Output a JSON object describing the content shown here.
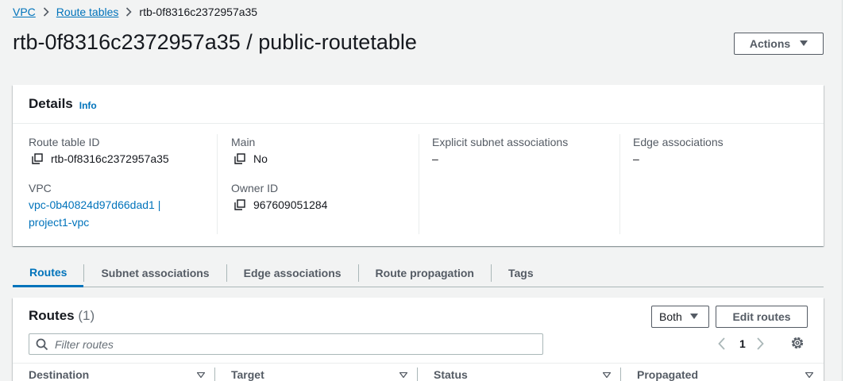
{
  "breadcrumb": {
    "items": [
      "VPC",
      "Route tables"
    ],
    "current": "rtb-0f8316c2372957a35"
  },
  "page": {
    "title": "rtb-0f8316c2372957a35 / public-routetable",
    "actions_label": "Actions"
  },
  "details": {
    "heading": "Details",
    "info_label": "Info",
    "route_table_id_label": "Route table ID",
    "route_table_id_value": "rtb-0f8316c2372957a35",
    "vpc_label": "VPC",
    "vpc_value_line1": "vpc-0b40824d97d66dad1 |",
    "vpc_value_line2": "project1-vpc",
    "main_label": "Main",
    "main_value": "No",
    "owner_id_label": "Owner ID",
    "owner_id_value": "967609051284",
    "explicit_label": "Explicit subnet associations",
    "explicit_value": "–",
    "edge_label": "Edge associations",
    "edge_value": "–"
  },
  "tabs": [
    {
      "label": "Routes",
      "active": true
    },
    {
      "label": "Subnet associations",
      "active": false
    },
    {
      "label": "Edge associations",
      "active": false
    },
    {
      "label": "Route propagation",
      "active": false
    },
    {
      "label": "Tags",
      "active": false
    }
  ],
  "routes": {
    "title": "Routes",
    "count": "(1)",
    "filter_selected": "Both",
    "edit_label": "Edit routes",
    "filter_placeholder": "Filter routes",
    "current_page": "1",
    "columns": [
      "Destination",
      "Target",
      "Status",
      "Propagated"
    ]
  },
  "colors": {
    "link": "#0073bb",
    "background": "#f2f3f3",
    "text": "#16191f",
    "muted": "#545b64"
  },
  "icons": [
    "chevron-right-icon",
    "copy-icon",
    "caret-down-icon",
    "search-icon",
    "chevron-left-icon",
    "settings-icon",
    "sort-icon"
  ]
}
